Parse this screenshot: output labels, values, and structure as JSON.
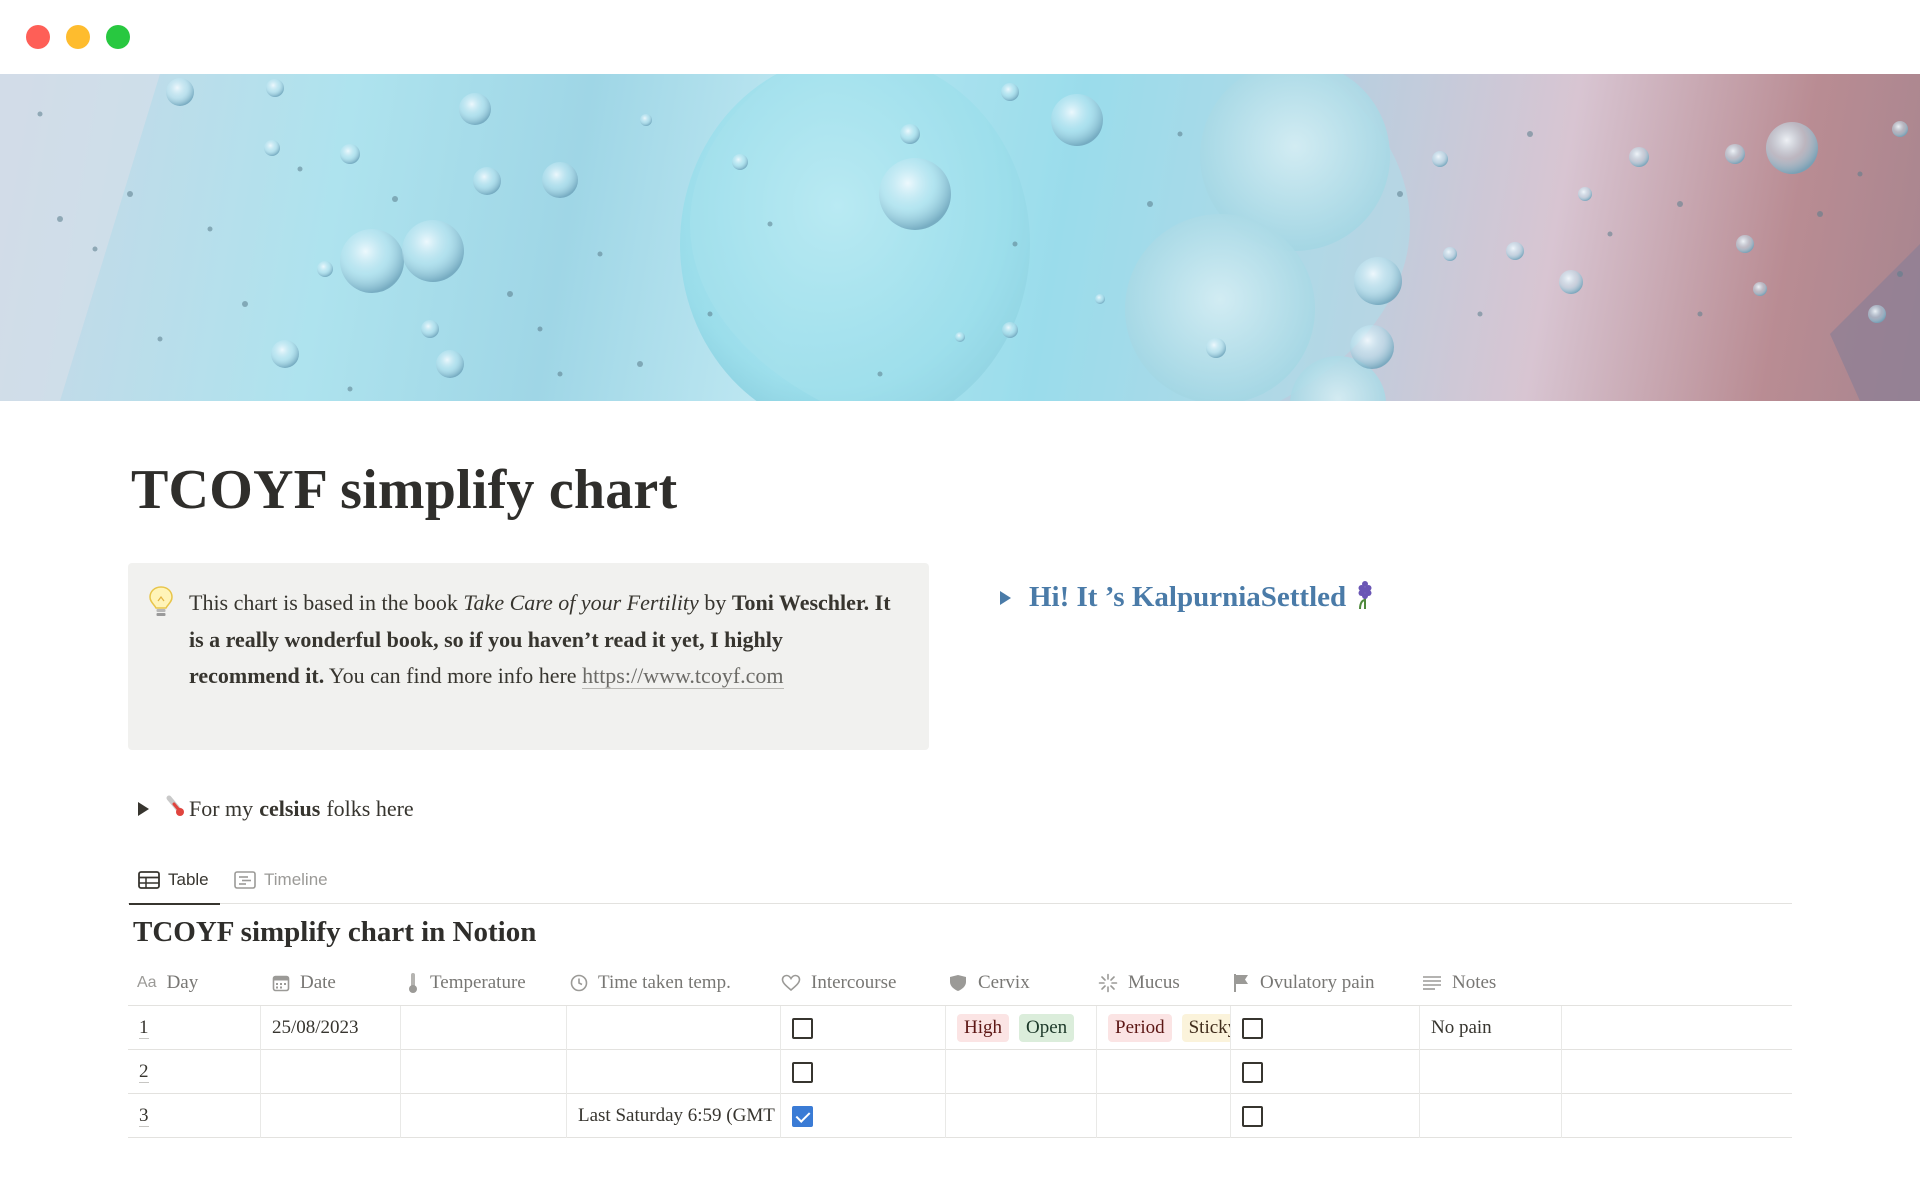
{
  "window": {
    "controls": [
      "close",
      "minimize",
      "maximize"
    ]
  },
  "cover": {
    "description_icon": "cover-image"
  },
  "page": {
    "title": "TCOYF simplify chart"
  },
  "callout": {
    "icon": "lightbulb-icon",
    "text_1": "This chart is based in the book ",
    "book_title": "Take Care of your Fertility",
    "text_2": " by ",
    "author_bold": "Toni Weschler. It is a really wonderful book, so if you haven’t read it yet, I highly recommend it.",
    "text_3": " You can find more info here ",
    "link": "https://www.tcoyf.com"
  },
  "toggle_hi": {
    "label": "Hi! It ’s KalpurniaSettled",
    "icon": "hyacinth-icon"
  },
  "toggle_celsius": {
    "prefix": "For my",
    "bold": "celsius",
    "suffix": "folks here",
    "icon": "thermometer-icon"
  },
  "tabs": [
    {
      "label": "Table",
      "icon": "table-icon",
      "active": true
    },
    {
      "label": "Timeline",
      "icon": "timeline-icon",
      "active": false
    }
  ],
  "database": {
    "title": "TCOYF simplify chart in Notion",
    "columns": [
      {
        "label": "Day",
        "icon": "text-aa-icon"
      },
      {
        "label": "Date",
        "icon": "calendar-icon"
      },
      {
        "label": "Temperature",
        "icon": "thermometer-icon"
      },
      {
        "label": "Time taken temp.",
        "icon": "clock-icon"
      },
      {
        "label": "Intercourse",
        "icon": "heart-icon"
      },
      {
        "label": "Cervix",
        "icon": "shield-icon"
      },
      {
        "label": "Mucus",
        "icon": "sparkle-icon"
      },
      {
        "label": "Ovulatory pain",
        "icon": "flag-icon"
      },
      {
        "label": "Notes",
        "icon": "lines-icon"
      }
    ],
    "rows": [
      {
        "day": "1",
        "date": "25/08/2023",
        "temperature": "",
        "time": "",
        "intercourse": false,
        "cervix": [
          "High",
          "Open"
        ],
        "mucus": [
          "Period",
          "Sticky"
        ],
        "ovulatory_pain": false,
        "notes": "No pain"
      },
      {
        "day": "2",
        "date": "",
        "temperature": "",
        "time": "",
        "intercourse": false,
        "cervix": [],
        "mucus": [],
        "ovulatory_pain": false,
        "notes": ""
      },
      {
        "day": "3",
        "date": "",
        "temperature": "",
        "time": "Last Saturday 6:59 (GMT",
        "intercourse": true,
        "cervix": [],
        "mucus": [],
        "ovulatory_pain": false,
        "notes": ""
      }
    ],
    "tag_colors": {
      "High": {
        "bg": "#fbe4e4",
        "fg": "#5d1715"
      },
      "Open": {
        "bg": "#dbeddb",
        "fg": "#1c3829"
      },
      "Period": {
        "bg": "#fbe4e4",
        "fg": "#5d1715"
      },
      "Sticky": {
        "bg": "#fbf3db",
        "fg": "#402c1b"
      }
    }
  },
  "colors": {
    "accent_link": "#4a7ba8",
    "callout_bg": "#f1f1ef",
    "checkbox_on": "#3a7bd5"
  }
}
